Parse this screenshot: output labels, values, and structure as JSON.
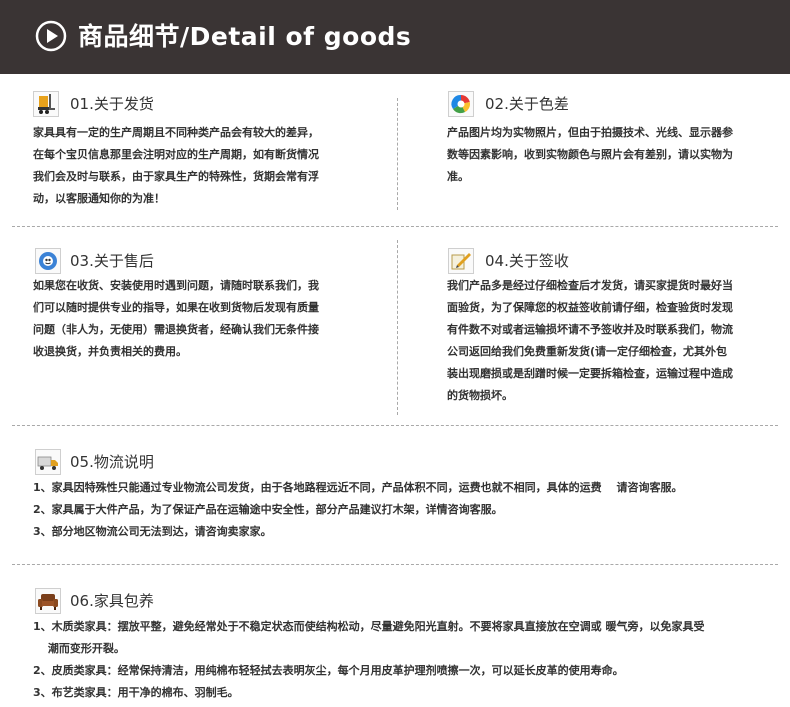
{
  "header": {
    "title": "商品细节/Detail of goods"
  },
  "s1": {
    "title": "01.关于发货",
    "lines": [
      "家具具有一定的生产周期且不同种类产品会有较大的差异，",
      "在每个宝贝信息那里会注明对应的生产周期，如有断货情况",
      "我们会及时与联系，由于家具生产的特殊性，货期会常有浮",
      "动，以客服通知你的为准！"
    ]
  },
  "s2": {
    "title": "02.关于色差",
    "lines": [
      "产品图片均为实物照片，但由于拍摄技术、光线、显示器参",
      "数等因素影响，收到实物颜色与照片会有差别，请以实物为",
      "准。"
    ]
  },
  "s3": {
    "title": "03.关于售后",
    "lines": [
      "如果您在收货、安装使用时遇到问题，请随时联系我们，我",
      "们可以随时提供专业的指导，如果在收到货物后发现有质量",
      "问题（非人为，无使用）需退换货者，经确认我们无条件接",
      "收退换货，并负责相关的费用。"
    ]
  },
  "s4": {
    "title": "04.关于签收",
    "lines": [
      "我们产品多是经过仔细检查后才发货，请买家提货时最好当",
      "面验货，为了保障您的权益签收前请仔细，检查验货时发现",
      "有件数不对或者运输损坏请不予签收并及时联系我们，物流",
      "公司返回给我们免费重新发货(请一定仔细检查，尤其外包",
      "装出现磨损或是刮蹭时候一定要拆箱检查，运输过程中造成",
      "的货物损坏。"
    ]
  },
  "s5": {
    "title": "05.物流说明",
    "lines": [
      "1、家具因特殊性只能通过专业物流公司发货，由于各地路程远近不同，产品体积不同，运费也就不相同，具体的运费　 请咨询客服。",
      "2、家具属于大件产品，为了保证产品在运输途中安全性，部分产品建议打木架，详情咨询客服。",
      "3、部分地区物流公司无法到达，请咨询卖家家。"
    ]
  },
  "s6": {
    "title": "06.家具包养",
    "lines": [
      "1、木质类家具：摆放平整，避免经常处于不稳定状态而使结构松动，尽量避免阳光直射。不要将家具直接放在空调或 暖气旁，以免家具受",
      "　 潮而变形开裂。",
      "2、皮质类家具：经常保持清洁，用纯棉布轻轻拭去表明灰尘，每个月用皮革护理剂喷擦一次，可以延长皮革的使用寿命。",
      "3、布艺类家具：用干净的棉布、羽制毛。"
    ]
  },
  "colors": {
    "header_bg": "#3a3434",
    "divider": "#a9a9a9",
    "text": "#333333"
  },
  "icons": {
    "header": "play-circle-icon",
    "s1": "forklift-icon",
    "s2": "color-wheel-icon",
    "s3": "support-globe-icon",
    "s4": "pen-sign-icon",
    "s5": "truck-icon",
    "s6": "sofa-icon"
  }
}
